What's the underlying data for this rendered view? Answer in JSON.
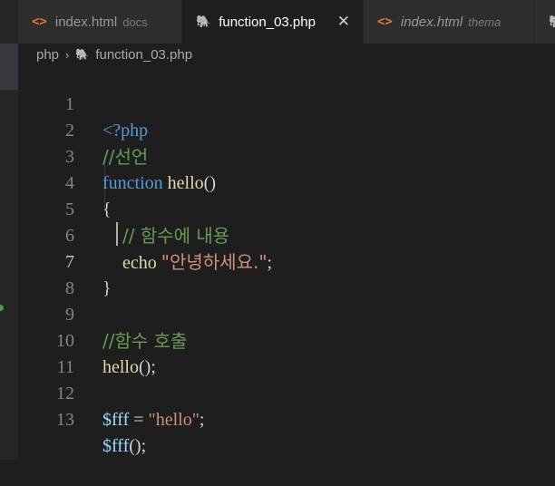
{
  "tabs": [
    {
      "name": "index.html",
      "desc": "docs",
      "icon": "html-icon"
    },
    {
      "name": "function_03.php",
      "desc": "",
      "icon": "php-elephant-icon",
      "close": "✕"
    },
    {
      "name": "index.html",
      "desc": "thema",
      "icon": "html-icon"
    },
    {
      "name": "",
      "desc": "",
      "icon": "php-elephant-icon"
    }
  ],
  "breadcrumb": {
    "folder": "php",
    "separator": "›",
    "file": "function_03.php"
  },
  "lines": [
    {
      "n": "1",
      "t": [
        "<?php"
      ]
    },
    {
      "n": "2",
      "t": [
        "//선언"
      ]
    },
    {
      "n": "3",
      "t": [
        "function",
        " ",
        "hello",
        "()"
      ]
    },
    {
      "n": "4",
      "t": [
        "{"
      ]
    },
    {
      "n": "5",
      "t": [
        "// 함수에 내용"
      ]
    },
    {
      "n": "6",
      "t": [
        "echo",
        " ",
        "\"안녕하세요.\"",
        ";"
      ]
    },
    {
      "n": "7",
      "t": [
        "}"
      ]
    },
    {
      "n": "8",
      "t": []
    },
    {
      "n": "9",
      "t": [
        "//함수 호출"
      ]
    },
    {
      "n": "10",
      "t": [
        "hello",
        "();"
      ]
    },
    {
      "n": "11",
      "t": []
    },
    {
      "n": "12",
      "t": [
        "$fff",
        " = ",
        "\"hello\"",
        ";"
      ]
    },
    {
      "n": "13",
      "t": [
        "$fff",
        "();"
      ]
    }
  ],
  "colors": {
    "background": "#1e1e1e",
    "keyword": "#569cd6",
    "function": "#dcdcaa",
    "comment": "#6a9955",
    "string": "#ce9178",
    "variable": "#9cdcfe"
  }
}
